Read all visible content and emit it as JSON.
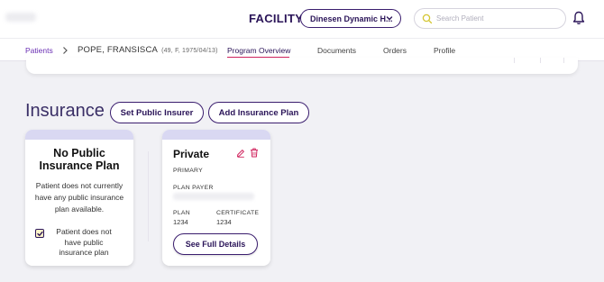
{
  "header": {
    "facility_label": "FACILITY",
    "facility_selected": "Dinesen Dynamic H...",
    "search_placeholder": "Search Patient"
  },
  "breadcrumb": {
    "root": "Patients",
    "patient_name": "POPE, FRANSISCA",
    "patient_meta": "(49, F, 1975/04/13)"
  },
  "tabs": [
    {
      "label": "Program Overview",
      "active": true
    },
    {
      "label": "Documents",
      "active": false
    },
    {
      "label": "Orders",
      "active": false
    },
    {
      "label": "Profile",
      "active": false
    }
  ],
  "insurance": {
    "title": "Insurance",
    "set_public_label": "Set Public Insurer",
    "add_plan_label": "Add Insurance Plan",
    "no_public": {
      "title": "No Public Insurance Plan",
      "description": "Patient does not currently have any public insurance plan available.",
      "checkbox_label": "Patient does not have public insurance plan",
      "checked": true
    },
    "private_plan": {
      "title": "Private",
      "priority": "PRIMARY",
      "payer_label": "PLAN PAYER",
      "plan_label": "PLAN",
      "plan_value": "1234",
      "certificate_label": "CERTIFICATE",
      "certificate_value": "1234",
      "details_label": "See Full Details"
    }
  },
  "colors": {
    "brand": "#2a1458",
    "accent": "#d0245e",
    "link": "#6a2fb3",
    "card_band": "#d9d8f2"
  }
}
